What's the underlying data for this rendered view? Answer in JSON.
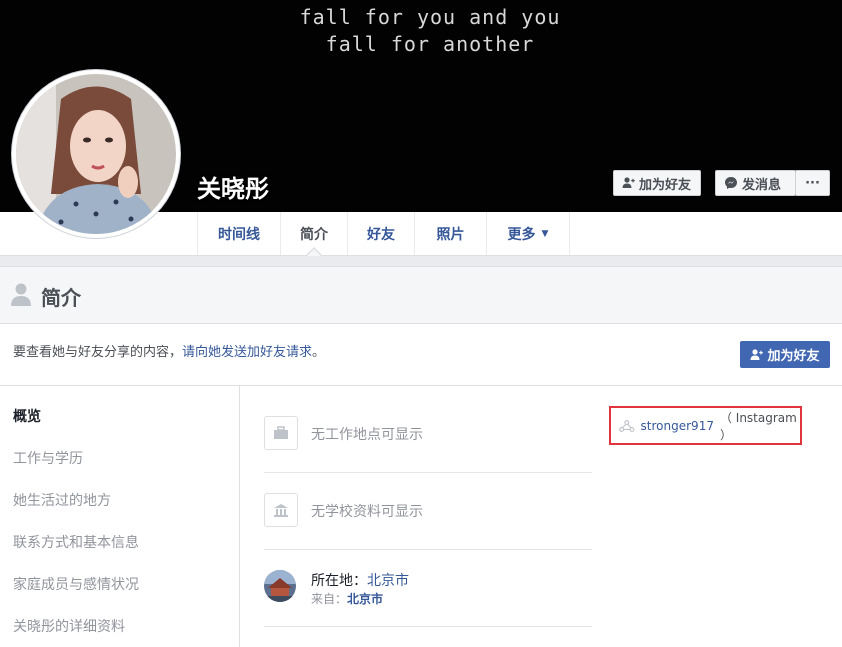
{
  "cover": {
    "caption_line1": "fall for you and you",
    "caption_line2": "fall for another"
  },
  "profile": {
    "name": "关晓彤",
    "add_friend_label": "加为好友",
    "message_label": "发消息",
    "more_label": "···"
  },
  "tabs": [
    {
      "label": "时间线"
    },
    {
      "label": "简介"
    },
    {
      "label": "好友"
    },
    {
      "label": "照片"
    },
    {
      "label": "更多"
    }
  ],
  "section": {
    "title": "简介"
  },
  "info": {
    "text": "要查看她与好友分享的内容，",
    "link": "请向她发送加好友请求",
    "suffix": "。",
    "button": "加为好友"
  },
  "left_nav": [
    {
      "label": "概览"
    },
    {
      "label": "工作与学历"
    },
    {
      "label": "她生活过的地方"
    },
    {
      "label": "联系方式和基本信息"
    },
    {
      "label": "家庭成员与感情状况"
    },
    {
      "label": "关晓彤的详细资料"
    }
  ],
  "rows": {
    "work": "无工作地点可显示",
    "school": "无学校资料可显示",
    "location_prefix": "所在地：",
    "location_city": "北京市",
    "from_prefix": "来自：",
    "from_city": "北京市"
  },
  "instagram": {
    "username": "stronger917",
    "service": "（ Instagram ）"
  },
  "colors": {
    "link_blue": "#365899",
    "primary_button": "#4267b2",
    "highlight_red": "#e0353f",
    "cover_bg": "#020203"
  }
}
